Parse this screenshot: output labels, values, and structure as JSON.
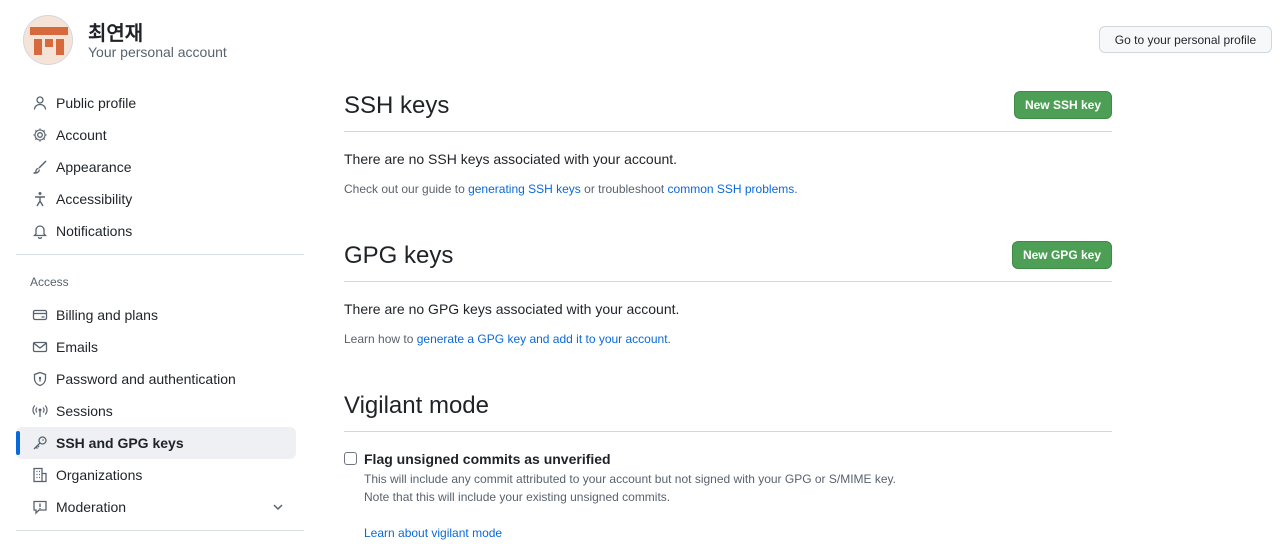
{
  "header": {
    "user_name": "최연재",
    "user_subtitle": "Your personal account",
    "profile_button": "Go to your personal profile",
    "avatar_colors": {
      "bg": "#f6e3d8",
      "fg": "#d66a3d"
    }
  },
  "sidebar": {
    "items": [
      {
        "label": "Public profile",
        "icon": "person-icon"
      },
      {
        "label": "Account",
        "icon": "gear-icon"
      },
      {
        "label": "Appearance",
        "icon": "paintbrush-icon"
      },
      {
        "label": "Accessibility",
        "icon": "accessibility-icon"
      },
      {
        "label": "Notifications",
        "icon": "bell-icon"
      }
    ],
    "access_heading": "Access",
    "access_items": [
      {
        "label": "Billing and plans",
        "icon": "credit-card-icon"
      },
      {
        "label": "Emails",
        "icon": "mail-icon"
      },
      {
        "label": "Password and authentication",
        "icon": "shield-lock-icon"
      },
      {
        "label": "Sessions",
        "icon": "broadcast-icon"
      },
      {
        "label": "SSH and GPG keys",
        "icon": "key-icon",
        "active": true
      },
      {
        "label": "Organizations",
        "icon": "organization-icon"
      },
      {
        "label": "Moderation",
        "icon": "report-icon",
        "expandable": true
      }
    ]
  },
  "ssh": {
    "title": "SSH keys",
    "new_button": "New SSH key",
    "empty_text": "There are no SSH keys associated with your account.",
    "help_prefix": "Check out our guide to ",
    "help_link1": "generating SSH keys",
    "help_middle": " or troubleshoot ",
    "help_link2": "common SSH problems",
    "help_suffix": "."
  },
  "gpg": {
    "title": "GPG keys",
    "new_button": "New GPG key",
    "empty_text": "There are no GPG keys associated with your account.",
    "help_prefix": "Learn how to ",
    "help_link": "generate a GPG key and add it to your account",
    "help_suffix": "."
  },
  "vigilant": {
    "title": "Vigilant mode",
    "checkbox_label": "Flag unsigned commits as unverified",
    "checked": false,
    "note_line1": "This will include any commit attributed to your account but not signed with your GPG or S/MIME key.",
    "note_line2": "Note that this will include your existing unsigned commits.",
    "learn_link": "Learn about vigilant mode"
  },
  "colors": {
    "accent": "#0969da",
    "primary_button": "#4d9f55",
    "active_indicator": "#0969da"
  }
}
